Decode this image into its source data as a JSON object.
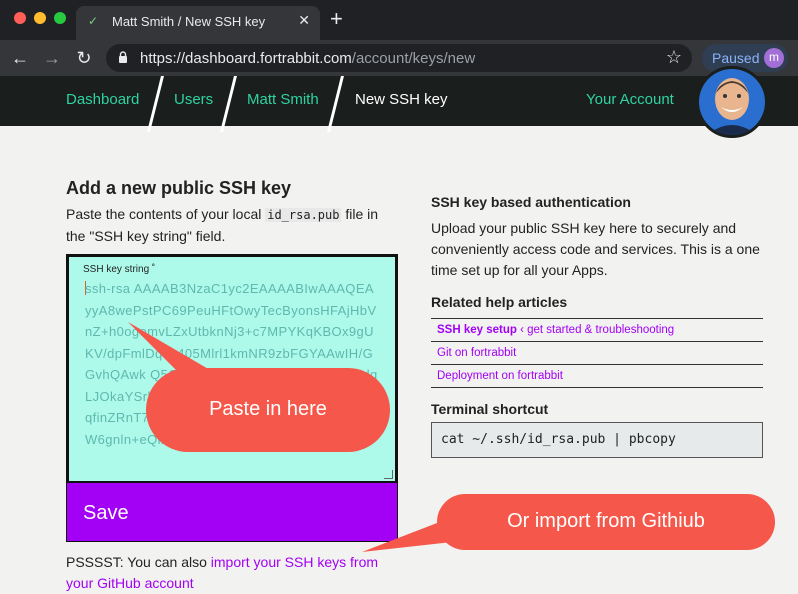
{
  "browser": {
    "tab_title": "Matt Smith / New SSH key",
    "tab_close": "✕",
    "new_tab": "+",
    "url_host": "https://dashboard.fortrabbit.com",
    "url_path": "/account/keys/new",
    "paused_label": "Paused",
    "profile_initial": "m",
    "icons": {
      "back": "←",
      "forward": "→",
      "reload": "↻",
      "star": "☆",
      "favicon": "✓"
    }
  },
  "header": {
    "breadcrumbs": [
      "Dashboard",
      "Users",
      "Matt Smith",
      "New SSH key"
    ],
    "account_link": "Your Account"
  },
  "form": {
    "title": "Add a new public SSH key",
    "intro_before": "Paste the contents of your local ",
    "intro_code": "id_rsa.pub",
    "intro_after": " file in the \"SSH key string\" field.",
    "field_label": "SSH key string ˚",
    "placeholder": "ssh-rsa AAAAB3NzaC1yc2EAAAABIwAAAQEAyyA8wePstPC69PeuHFtOwyTecByonsHFAjHbVnZ+h0ogomvLZxUtbknNj3+c7MPYKqKBOx9gUKV/dpFmlDqsb405Mlrl1kmNR9zbFGYAAwIH/GGvhQAwk Q5OKOM75GRCi0H3twEvDfFxNGdqLJOkaYSrb5PPyGUUSZJgyXa1fCKqTeYnYJnHqfinZRnT7jkZ0OZ7YmXo6j4Hyms3RCOqenlX1W6gnln+eQlkw=="
  },
  "save_label": "Save",
  "pssst": {
    "prefix": "PSSSST: You can also ",
    "link": "import your SSH keys from your GitHub account"
  },
  "sidebar": {
    "title": "SSH key based authentication",
    "text": "Upload your public SSH key here to securely and conveniently access code and services. This is a one time set up for all your Apps.",
    "help_title": "Related help articles",
    "help_items": [
      {
        "strong": "SSH key setup",
        "rest": " ‹ get started & troubleshooting"
      },
      {
        "strong": "",
        "rest": "Git on fortrabbit"
      },
      {
        "strong": "",
        "rest": "Deployment on fortrabbit"
      }
    ],
    "terminal_title": "Terminal shortcut",
    "terminal_command": "cat ~/.ssh/id_rsa.pub | pbcopy"
  },
  "callouts": {
    "paste": "Paste in here",
    "import": "Or import from Githiub"
  },
  "colors": {
    "accent_purple": "#a300f6",
    "header_green": "#2fd2a0",
    "callout_red": "#f5574a",
    "textarea_bg": "#adfaea"
  }
}
